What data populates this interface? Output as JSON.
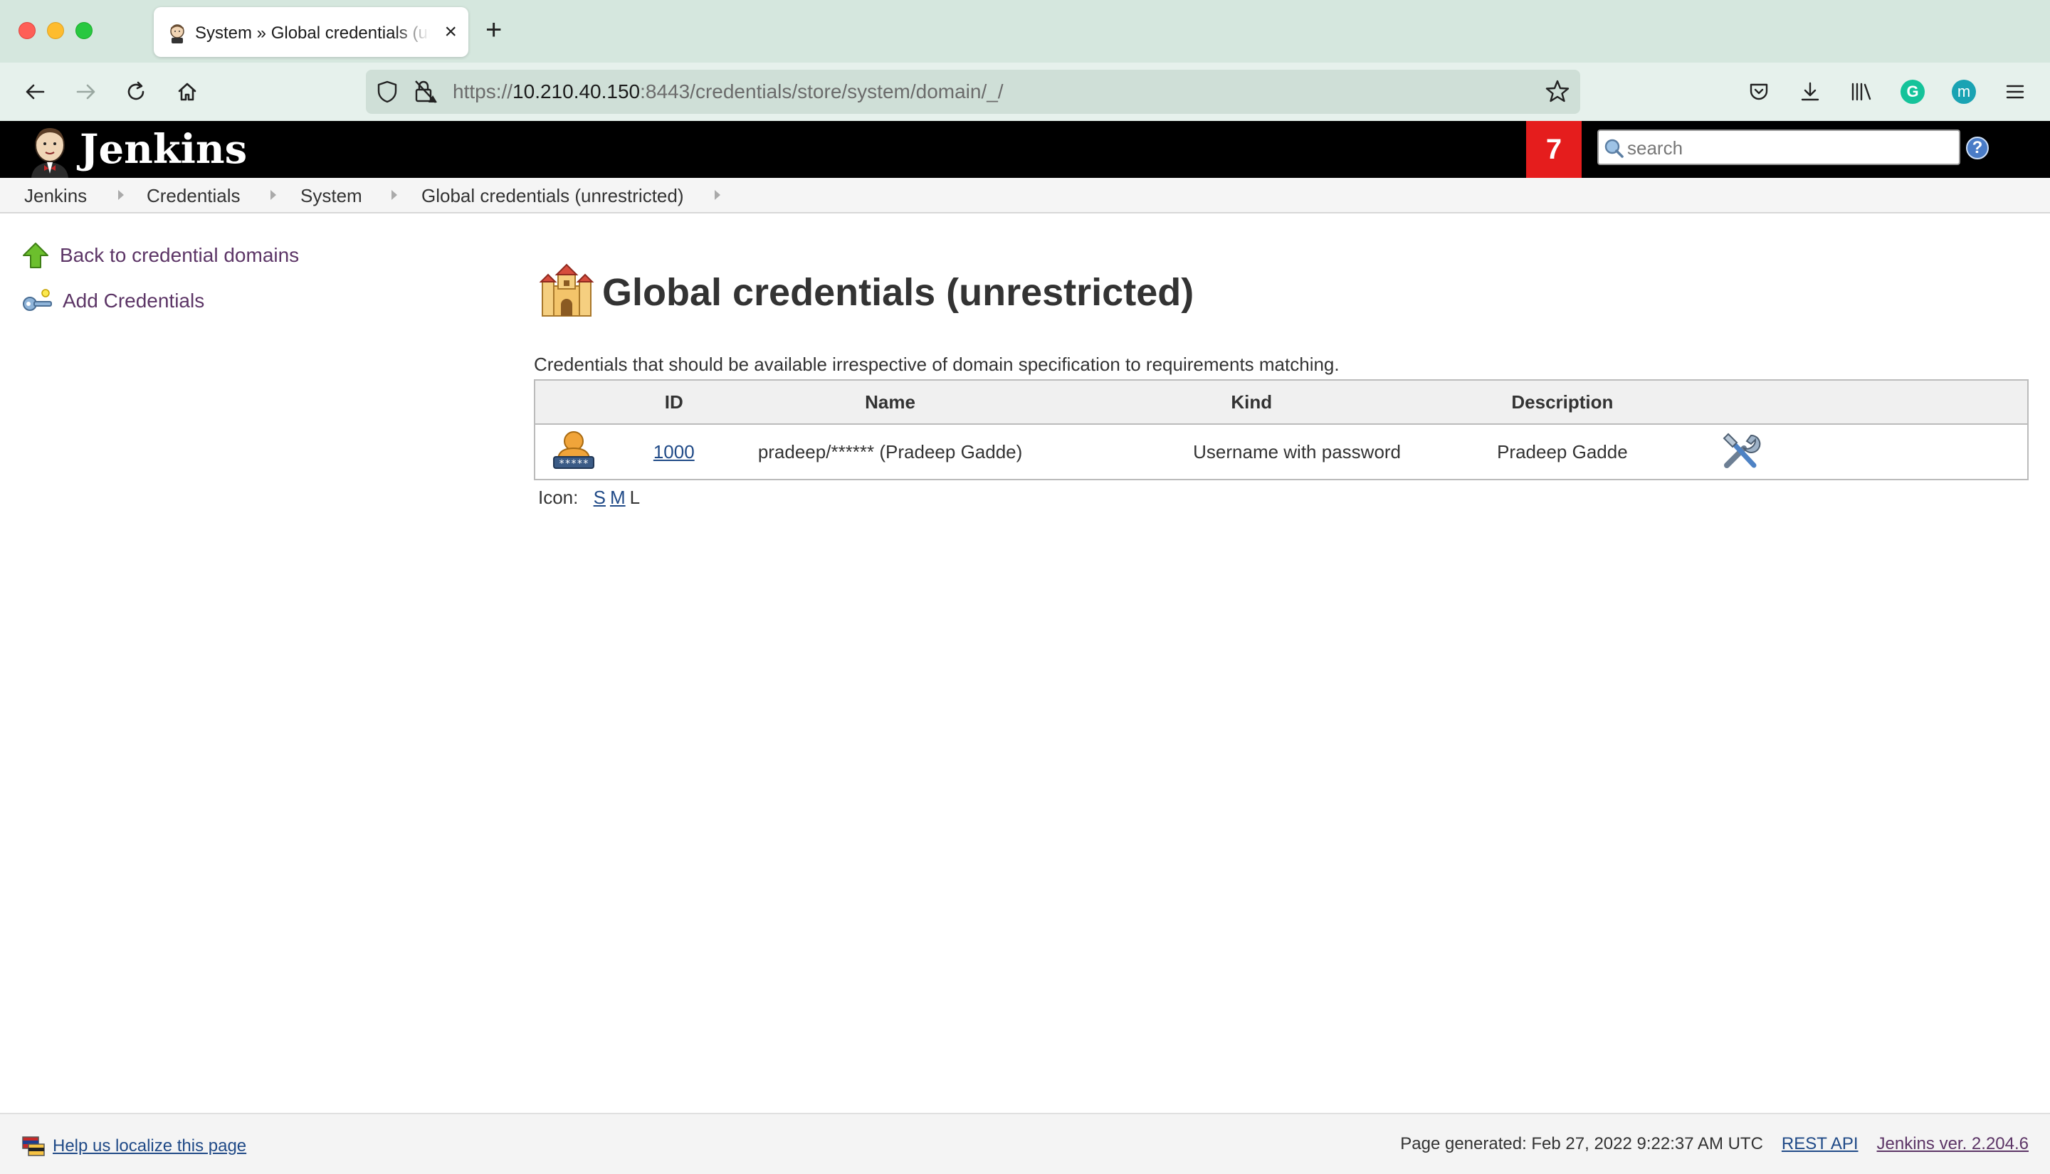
{
  "browser": {
    "tab_title": "System » Global credentials (unrestricted)",
    "url_scheme": "https://",
    "url_host": "10.210.40.150",
    "url_rest": ":8443/credentials/store/system/domain/_/",
    "ext_grammarly_letter": "G",
    "ext_m_letter": "m"
  },
  "header": {
    "app_name": "Jenkins",
    "notification_count": "7",
    "search_placeholder": "search",
    "help_label": "?"
  },
  "breadcrumbs": [
    "Jenkins",
    "Credentials",
    "System",
    "Global credentials (unrestricted)"
  ],
  "sidebar": {
    "items": [
      {
        "label": "Back to credential domains",
        "icon": "up-arrow-icon"
      },
      {
        "label": "Add Credentials",
        "icon": "key-icon"
      }
    ]
  },
  "main": {
    "title": "Global credentials (unrestricted)",
    "description": "Credentials that should be available irrespective of domain specification to requirements matching.",
    "table": {
      "columns": [
        "ID",
        "Name",
        "Kind",
        "Description"
      ],
      "rows": [
        {
          "id": "1000",
          "name": "pradeep/****** (Pradeep Gadde)",
          "kind": "Username with password",
          "description": "Pradeep Gadde"
        }
      ]
    },
    "icon_size": {
      "label": "Icon:",
      "options": [
        "S",
        "M",
        "L"
      ],
      "selected": "L"
    }
  },
  "footer": {
    "localize_link": "Help us localize this page",
    "generated": "Page generated: Feb 27, 2022 9:22:37 AM UTC",
    "rest_api": "REST API",
    "version": "Jenkins ver. 2.204.6"
  },
  "colors": {
    "header_bg": "#000000",
    "badge_bg": "#e51d1d",
    "link": "#5c3566",
    "link_blue": "#204a87"
  }
}
